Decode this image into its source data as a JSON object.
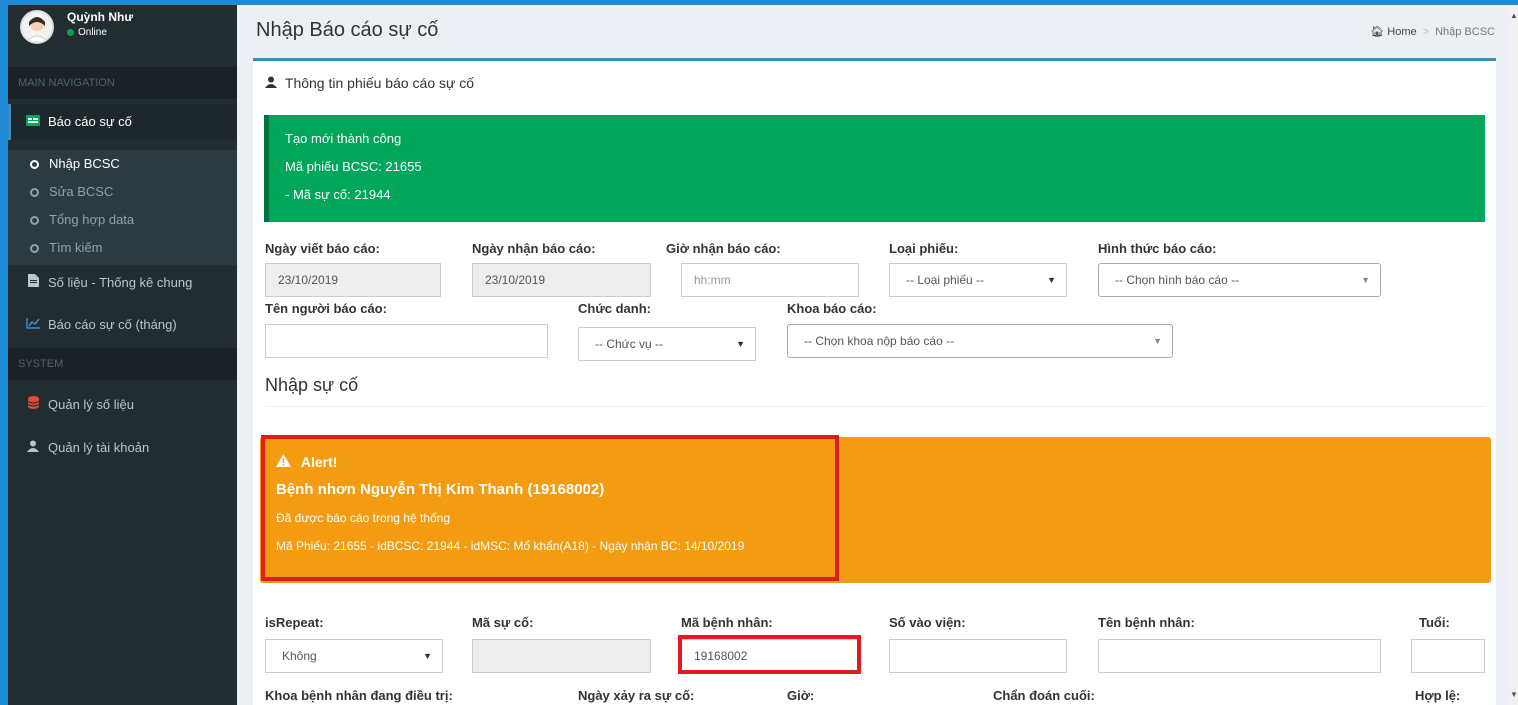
{
  "user": {
    "name": "Quỳnh Như",
    "status": "Online"
  },
  "nav": {
    "main_header": "MAIN NAVIGATION",
    "bcsc": "Báo cáo sự cố",
    "sub": [
      "Nhập BCSC",
      "Sửa BCSC",
      "Tổng hợp data",
      "Tìm kiếm"
    ],
    "so_lieu": "Số liệu - Thống kê chung",
    "bc_thang": "Báo cáo sự cố (tháng)",
    "system_header": "SYSTEM",
    "ql_so_lieu": "Quản lý số liệu",
    "ql_tai_khoan": "Quản lý tài khoản"
  },
  "page": {
    "title": "Nhập Báo cáo sự cố",
    "crumb_home": "Home",
    "crumb_sep": ">",
    "crumb_current": "Nhập BCSC"
  },
  "box": {
    "title": "Thông tin phiếu báo cáo sự cố"
  },
  "success": {
    "line1": "Tạo mới thành công",
    "line2": "Mã phiếu BCSC: 21655",
    "line3": "- Mã sự cố: 21944"
  },
  "form1": {
    "ngay_viet_label": "Ngày viết báo cáo:",
    "ngay_viet_value": "23/10/2019",
    "ngay_nhan_label": "Ngày nhận báo cáo:",
    "ngay_nhan_value": "23/10/2019",
    "gio_nhan_label": "Giờ nhận báo cáo:",
    "gio_nhan_placeholder": "hh:mm",
    "loai_phieu_label": "Loại phiếu:",
    "loai_phieu_value": "-- Loại phiếu --",
    "hinh_thuc_label": "Hình thức báo cáo:",
    "hinh_thuc_value": "-- Chọn hình báo cáo --",
    "ten_nguoi_label": "Tên người báo cáo:",
    "chuc_danh_label": "Chức danh:",
    "chuc_danh_value": "-- Chức vụ --",
    "khoa_label": "Khoa báo cáo:",
    "khoa_value": "-- Chọn khoa nộp báo cáo --"
  },
  "section": {
    "title": "Nhập sự cố"
  },
  "alert": {
    "heading": "Alert!",
    "line1": "Bệnh nhơn Nguyễn Thị Kim Thanh (19168002)",
    "line2": "Đã được báo cáo trong hệ thống",
    "line3": "Mã Phiếu: 21655 - idBCSC: 21944 - idMSC: Mổ khẩn(A18) - Ngày nhận BC: 14/10/2019"
  },
  "form2": {
    "is_repeat_label": "isRepeat:",
    "is_repeat_value": "Không",
    "ma_su_co_label": "Mã sự cố:",
    "ma_bn_label": "Mã bệnh nhân:",
    "ma_bn_value": "19168002",
    "so_vao_vien_label": "Số vào viện:",
    "ten_bn_label": "Tên bệnh nhân:",
    "tuoi_label": "Tuổi:",
    "khoa_bn_label": "Khoa bệnh nhân đang điều trị:",
    "ngay_xay_ra_label": "Ngày xảy ra sự cố:",
    "gio_label": "Giờ:",
    "chan_doan_label": "Chẩn đoán cuối:",
    "hop_le_label": "Hợp lệ:"
  },
  "colors": {
    "sidebar": "#222d32",
    "success": "#00a65a",
    "warning": "#f39c12",
    "highlight": "#e01b24",
    "accent": "#3c8dbc"
  }
}
